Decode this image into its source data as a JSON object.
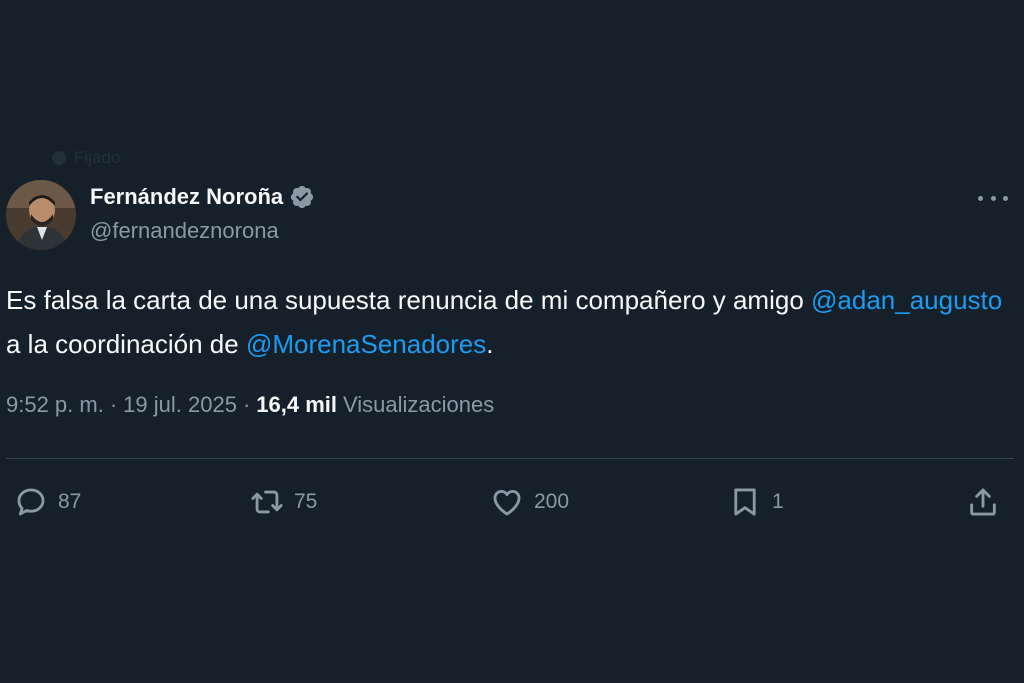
{
  "context_label": "Fijado",
  "author": {
    "display_name": "Fernández Noroña",
    "handle": "@fernandeznorona",
    "verified": true
  },
  "tweet": {
    "text_part1": "Es falsa la carta de una supuesta renuncia de mi compañero y amigo ",
    "mention1": "@adan_augusto",
    "text_part2": " a la coordinación de ",
    "mention2": "@MorenaSenadores",
    "text_part3": "."
  },
  "meta": {
    "time": "9:52 p. m.",
    "separator": "·",
    "date": "19 jul. 2025",
    "views_count": "16,4 mil",
    "views_label": "Visualizaciones"
  },
  "actions": {
    "replies": "87",
    "reposts": "75",
    "likes": "200",
    "bookmarks": "1"
  },
  "colors": {
    "background": "#15202b",
    "text": "#f7f9f9",
    "muted": "#8b98a5",
    "link": "#1d9bf0",
    "divider": "#38444d"
  }
}
